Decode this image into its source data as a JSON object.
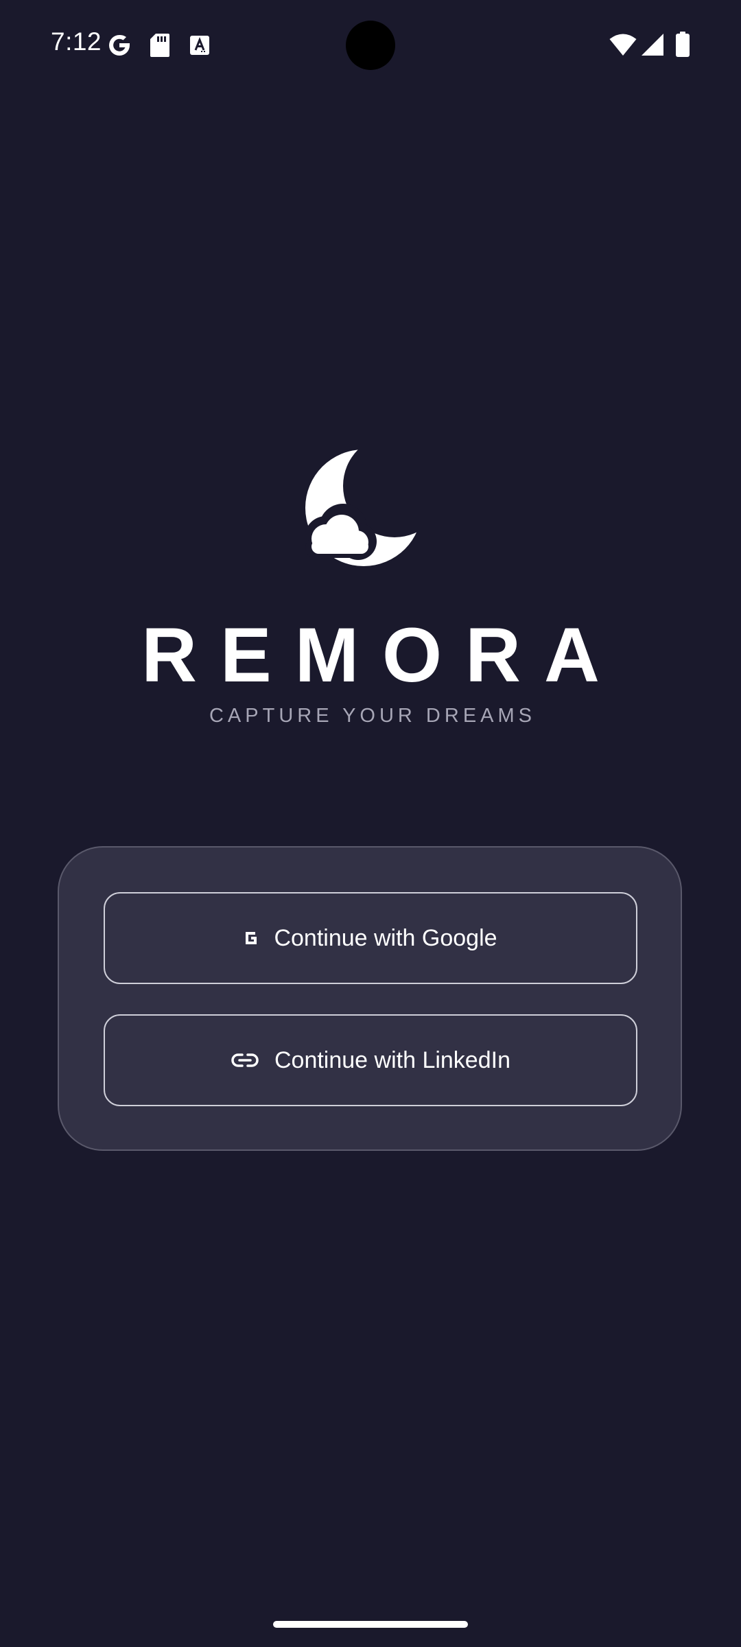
{
  "status_bar": {
    "time": "7:12",
    "left_icons": [
      "google-icon",
      "sd-card-icon",
      "text-a-icon"
    ],
    "right_icons": [
      "wifi-icon",
      "cellular-signal-icon",
      "battery-icon"
    ]
  },
  "brand": {
    "logo_icon": "moon-cloud-icon",
    "app_name": "REMORA",
    "tagline": "CAPTURE YOUR DREAMS"
  },
  "auth": {
    "google": {
      "label": "Continue with Google",
      "icon": "google-g-icon"
    },
    "linkedin": {
      "label": "Continue with LinkedIn",
      "icon": "link-icon"
    }
  },
  "colors": {
    "background": "#1a192c",
    "card": "#323145",
    "card_border": "#5a596b",
    "button_border": "#cfcfd9",
    "text_primary": "#ffffff",
    "text_secondary": "#a7a6b6"
  }
}
